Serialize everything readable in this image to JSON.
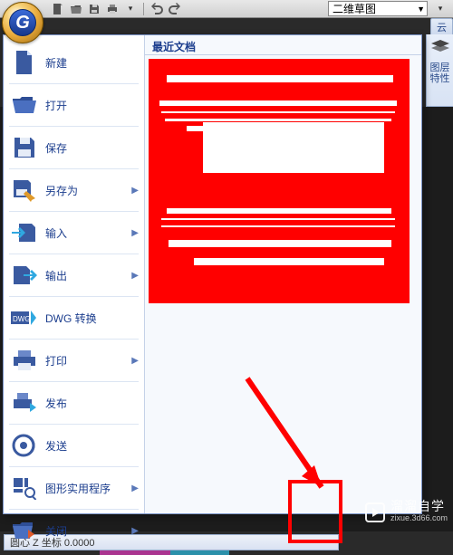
{
  "titlebar": {
    "workspace": "二维草图"
  },
  "ribbon": {
    "right_tab": "云",
    "panel_label_line1": "图层",
    "panel_label_line2": "特性"
  },
  "appmenu": {
    "right_header": "最近文档",
    "items": [
      {
        "label": "新建",
        "arrow": false
      },
      {
        "label": "打开",
        "arrow": false
      },
      {
        "label": "保存",
        "arrow": false
      },
      {
        "label": "另存为",
        "arrow": true
      },
      {
        "label": "输入",
        "arrow": true
      },
      {
        "label": "输出",
        "arrow": true
      },
      {
        "label": "DWG 转换",
        "arrow": false
      },
      {
        "label": "打印",
        "arrow": true
      },
      {
        "label": "发布",
        "arrow": false
      },
      {
        "label": "发送",
        "arrow": false
      },
      {
        "label": "图形实用程序",
        "arrow": true
      },
      {
        "label": "关闭",
        "arrow": true
      }
    ]
  },
  "status": {
    "text": "圆心 Z 坐标 0.0000"
  },
  "watermark": {
    "cn": "溜溜自学",
    "en": "zixue.3d66.com"
  }
}
